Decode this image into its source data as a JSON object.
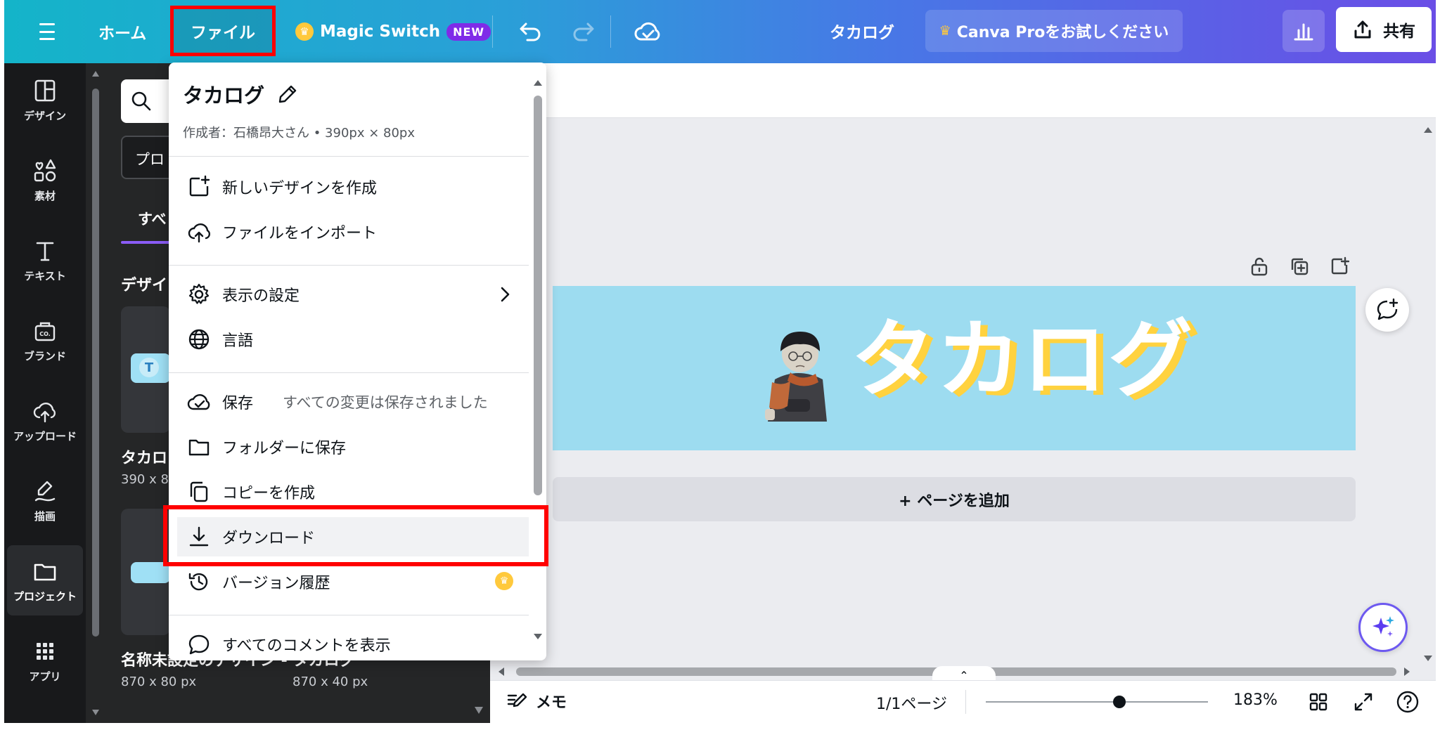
{
  "topbar": {
    "home": "ホーム",
    "file": "ファイル",
    "magic_switch": "Magic Switch",
    "new_badge": "NEW",
    "design_title": "タカログ",
    "pro_trial": "Canva Proをお試しください",
    "share": "共有"
  },
  "rail": {
    "items": [
      {
        "label": "デザイン",
        "icon": "layout-icon"
      },
      {
        "label": "素材",
        "icon": "elements-icon"
      },
      {
        "label": "テキスト",
        "icon": "text-icon"
      },
      {
        "label": "ブランド",
        "icon": "brand-icon"
      },
      {
        "label": "アップロード",
        "icon": "upload-icon"
      },
      {
        "label": "描画",
        "icon": "draw-icon"
      },
      {
        "label": "プロジェクト",
        "icon": "folder-icon"
      },
      {
        "label": "アプリ",
        "icon": "apps-icon"
      }
    ]
  },
  "panel": {
    "dropdown_partial": "プロ",
    "tab_partial": "すべ",
    "section_partial": "デザイ",
    "card1_title_partial": "タカロ",
    "card1_size_partial": "390 x 8",
    "bottom_title": "名称未設定のデザイン - タカログ",
    "bottom_size_1": "870 x 80 px",
    "bottom_size_2": "870 x 40 px"
  },
  "menu": {
    "title": "タカログ",
    "subtitle": "作成者：石橋昂大さん • 390px × 80px",
    "items": {
      "new_design": "新しいデザインを作成",
      "import_file": "ファイルをインポート",
      "view_settings": "表示の設定",
      "language": "言語",
      "save": "保存",
      "save_status": "すべての変更は保存されました",
      "save_to_folder": "フォルダーに保存",
      "make_copy": "コピーを作成",
      "download": "ダウンロード",
      "version_history": "バージョン履歴",
      "show_comments": "すべてのコメントを表示"
    }
  },
  "canvas": {
    "logo_text": "タカログ",
    "add_page": "+ ページを追加"
  },
  "bottombar": {
    "notes": "メモ",
    "page_count": "1/1ページ",
    "zoom": "183%",
    "zoom_fraction": 0.6
  },
  "colors": {
    "highlight": "#ff0000",
    "canvas_bg": "#9ddcf0",
    "logo_shadow": "#ffd23f",
    "pro_crown": "#ffc93c",
    "new_badge": "#7f2be8"
  }
}
